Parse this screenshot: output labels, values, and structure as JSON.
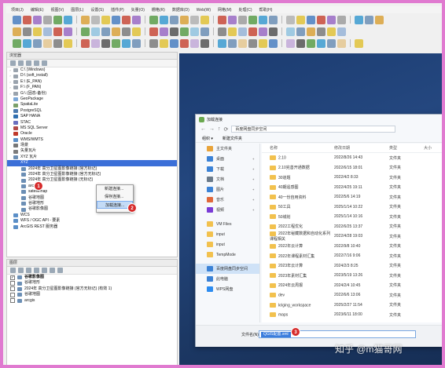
{
  "menubar": [
    "项目(J)",
    "编辑(E)",
    "视图(V)",
    "图层(L)",
    "设置(S)",
    "插件(P)",
    "矢量(O)",
    "栅格(R)",
    "数据库(D)",
    "Web(W)",
    "网格(M)",
    "处理(C)",
    "帮助(H)"
  ],
  "browser": {
    "title": "浏览器",
    "items": [
      {
        "label": "C:\\ (Windows)",
        "icon": "drive-icon",
        "color": "#9aa3ad"
      },
      {
        "label": "D:\\ (soft_install)",
        "icon": "drive-icon",
        "color": "#9aa3ad"
      },
      {
        "label": "E:\\ (E_PAN)",
        "icon": "drive-icon",
        "color": "#9aa3ad"
      },
      {
        "label": "F:\\ (F_PAN)",
        "icon": "drive-icon",
        "color": "#9aa3ad"
      },
      {
        "label": "G:\\ (固态-备份)",
        "icon": "drive-icon",
        "color": "#9aa3ad"
      },
      {
        "label": "GeoPackage",
        "icon": "geopackage-icon",
        "color": "#7ca8d8"
      },
      {
        "label": "SpatiaLite",
        "icon": "spatialite-icon",
        "color": "#7aa06a"
      },
      {
        "label": "PostgreSQL",
        "icon": "postgresql-icon",
        "color": "#4d7bb0"
      },
      {
        "label": "SAP HANA",
        "icon": "sap-hana-icon",
        "color": "#2f6fb0"
      },
      {
        "label": "STAC",
        "icon": "stac-icon",
        "color": "#6a6fc0"
      },
      {
        "label": "MS SQL Server",
        "icon": "mssql-icon",
        "color": "#b04a4a"
      },
      {
        "label": "Oracle",
        "icon": "oracle-icon",
        "color": "#c0392b"
      },
      {
        "label": "WMS/WMTS",
        "icon": "wms-icon",
        "color": "#5b8fc7"
      },
      {
        "label": "场景",
        "icon": "scene-icon",
        "color": "#777"
      },
      {
        "label": "矢量瓦片",
        "icon": "vector-tile-icon",
        "color": "#7d7d7d"
      },
      {
        "label": "XYZ 瓦片",
        "icon": "xyz-tiles-icon",
        "color": "#6c8fb5"
      },
      {
        "label": "XYZ",
        "icon": "xyz-icon",
        "color": "#3b6fd8",
        "selected": true
      },
      {
        "label": "2024年 高分卫星图影像链接 (官方标记)",
        "icon": "tile-icon",
        "color": "#6c8fb5"
      },
      {
        "label": "2024年 高分卫星图影像链接 (官方无标记)",
        "icon": "tile-icon",
        "color": "#6c8fb5"
      },
      {
        "label": "2024年 高分卫星图影像链接 (无标记)",
        "icon": "tile-icon",
        "color": "#6c8fb5"
      },
      {
        "label": "arcgis",
        "icon": "tile-icon",
        "color": "#6c8fb5"
      },
      {
        "label": "satellemap",
        "icon": "tile-icon",
        "color": "#6c8fb5"
      },
      {
        "label": "谷歌地图",
        "icon": "tile-icon",
        "color": "#6c8fb5"
      },
      {
        "label": "谷歌地形",
        "icon": "tile-icon",
        "color": "#6c8fb5"
      },
      {
        "label": "谷歌影像图",
        "icon": "tile-icon",
        "color": "#6c8fb5"
      },
      {
        "label": "WCS",
        "icon": "wcs-icon",
        "color": "#5b8fc7"
      },
      {
        "label": "WFS / OGC API - 要素",
        "icon": "wfs-icon",
        "color": "#5b8fc7"
      },
      {
        "label": "ArcGIS REST 服务器",
        "icon": "arcgis-rest-icon",
        "color": "#5b8fc7"
      }
    ]
  },
  "layers": {
    "title": "图层",
    "items": [
      {
        "label": "谷歌影像图",
        "checked": true,
        "bold": true
      },
      {
        "label": "谷歌地形",
        "checked": false
      },
      {
        "label": "2024年 高分卫星图影像链接 (官方无标记) (有效 1)",
        "checked": false
      },
      {
        "label": "谷歌地图",
        "checked": false
      },
      {
        "label": "arcgis",
        "checked": false
      }
    ]
  },
  "context_menu": {
    "items": [
      "新建连接...",
      "保存连接...",
      "加载连接..."
    ]
  },
  "badges": [
    "1",
    "2",
    "3"
  ],
  "dialog": {
    "title": "加载连接",
    "address": "百度网盘同步空间",
    "toolbar": {
      "organize": "组织 ▾",
      "new_folder": "新建文件夹"
    },
    "sidebar": [
      {
        "label": "主文件夹",
        "icon": "home-icon",
        "color": "#e8a33a"
      },
      {
        "label": "桌面",
        "icon": "desktop-icon",
        "color": "#3b82d6",
        "pin": true
      },
      {
        "label": "下载",
        "icon": "download-icon",
        "color": "#3b82d6",
        "pin": true
      },
      {
        "label": "文档",
        "icon": "documents-icon",
        "color": "#6a7a8a",
        "pin": true
      },
      {
        "label": "图片",
        "icon": "pictures-icon",
        "color": "#3b82d6",
        "pin": true
      },
      {
        "label": "音乐",
        "icon": "music-icon",
        "color": "#e0673a",
        "pin": true
      },
      {
        "label": "视频",
        "icon": "video-icon",
        "color": "#7a3bd6",
        "pin": true
      },
      {
        "label": "VM Files",
        "icon": "folder-icon",
        "color": "#f2c14e"
      },
      {
        "label": "input",
        "icon": "folder-icon",
        "color": "#f2c14e"
      },
      {
        "label": "input",
        "icon": "folder-icon",
        "color": "#f2c14e"
      },
      {
        "label": "TempMode",
        "icon": "folder-icon",
        "color": "#f2c14e"
      },
      {
        "label": "百度网盘同步空间",
        "icon": "baidu-sync-icon",
        "color": "#3b82d6",
        "selected": true
      },
      {
        "label": "此电脑",
        "icon": "computer-icon",
        "color": "#3b82d6"
      },
      {
        "label": "WPS网盘",
        "icon": "wps-cloud-icon",
        "color": "#2d8cf0"
      }
    ],
    "columns": [
      "名称",
      "修改日期",
      "类型",
      "大小"
    ],
    "files": [
      {
        "name": "2.10",
        "date": "2022/8/26 14:43",
        "type": "文件夹"
      },
      {
        "name": "2.10完善开通数据",
        "date": "2022/6/15 18:01",
        "type": "文件夹"
      },
      {
        "name": "30道题",
        "date": "2022/4/2 8:33",
        "type": "文件夹"
      },
      {
        "name": "40期遥感图",
        "date": "2022/4/25 19:11",
        "type": "文件夹"
      },
      {
        "name": "40一份自用资料",
        "date": "2022/5/6 14:19",
        "type": "文件夹"
      },
      {
        "name": "50工具",
        "date": "2025/1/14 10:22",
        "type": "文件夹"
      },
      {
        "name": "50城划",
        "date": "2025/1/14 10:16",
        "type": "文件夹"
      },
      {
        "name": "2022工程优化",
        "date": "2022/6/25 13:37",
        "type": "文件夹"
      },
      {
        "name": "2022年秘藏数据和自动化系列课程相关",
        "date": "2022/4/28 19:03",
        "type": "文件夹"
      },
      {
        "name": "2022年云计算",
        "date": "2022/9/8 10:40",
        "type": "文件夹"
      },
      {
        "name": "2022年课程素材汇集",
        "date": "2022/7/16 9:06",
        "type": "文件夹"
      },
      {
        "name": "2023年云计算",
        "date": "2024/2/3 8:25",
        "type": "文件夹"
      },
      {
        "name": "2023年素材汇集",
        "date": "2023/5/19 13:26",
        "type": "文件夹"
      },
      {
        "name": "2024年云周报",
        "date": "2024/2/4 10:45",
        "type": "文件夹"
      },
      {
        "name": "dev",
        "date": "2022/6/6 13:06",
        "type": "文件夹"
      },
      {
        "name": "kriging_workspace",
        "date": "2025/2/27 11:54",
        "type": "文件夹"
      },
      {
        "name": "maps",
        "date": "2023/6/11 18:00",
        "type": "文件夹"
      }
    ],
    "filename_label": "文件名(N):",
    "filename_value": "QGIS配置.xml"
  },
  "watermark": "知乎 @m猫哥网",
  "colors": {
    "frame": "#e07ad0",
    "selection": "#3b6fd8",
    "badge": "#d62b2b",
    "canvas": "#1b3b6f"
  }
}
